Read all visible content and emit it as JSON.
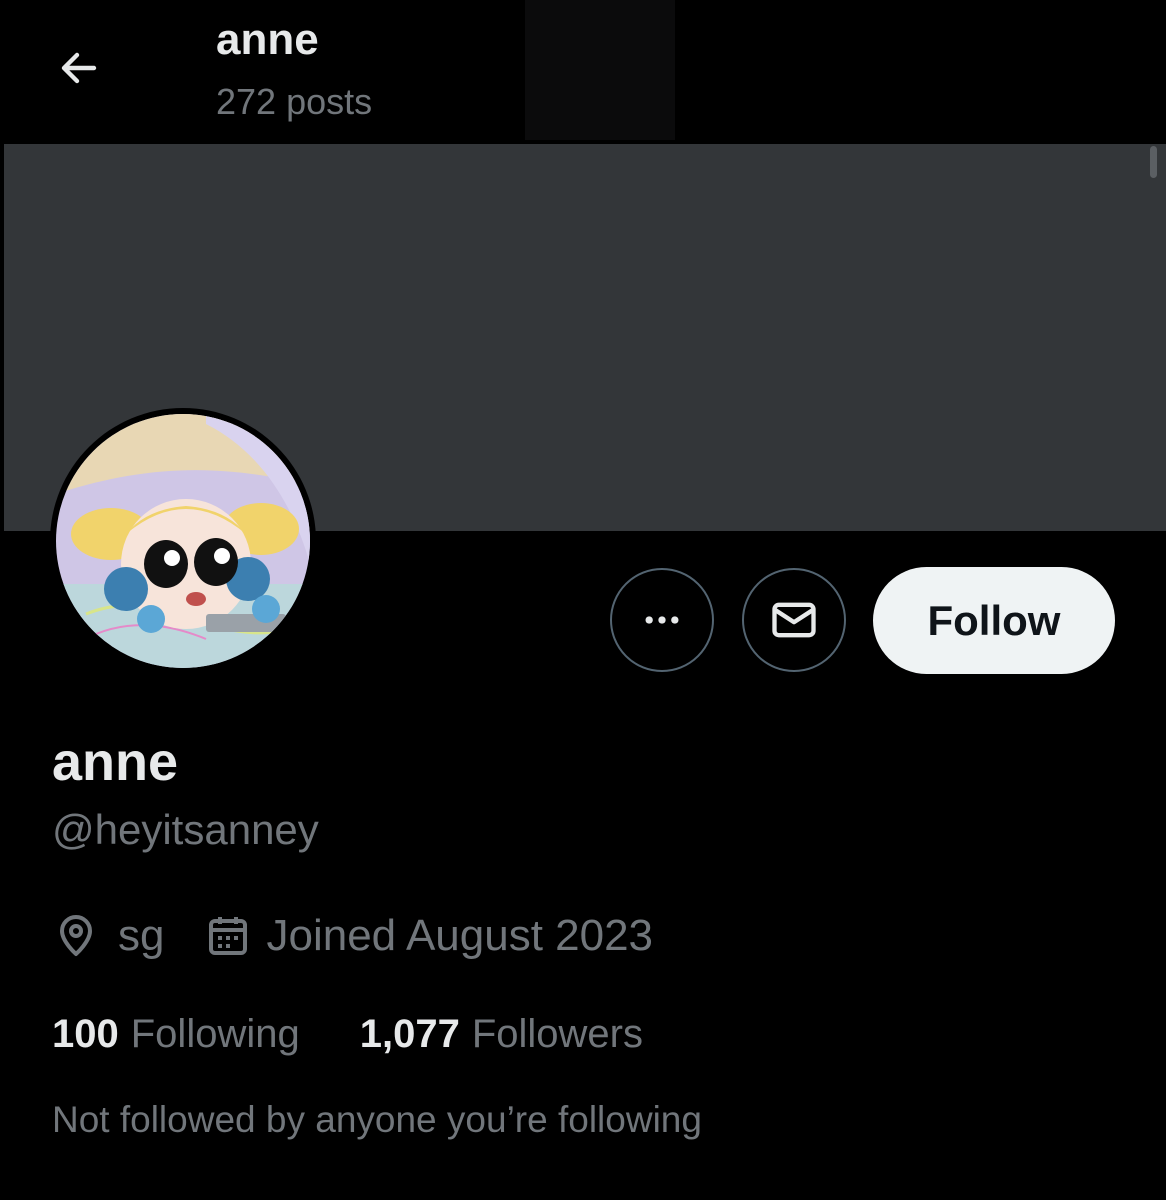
{
  "header": {
    "title": "anne",
    "post_count": "272 posts",
    "back_icon": "arrow-left-icon"
  },
  "banner": {
    "color": "#333639"
  },
  "avatar": {
    "description_icon": "avatar-image"
  },
  "actions": {
    "more_icon": "more-horizontal-icon",
    "message_icon": "envelope-icon",
    "follow_label": "Follow"
  },
  "profile": {
    "display_name": "anne",
    "handle": "@heyitsanney",
    "location": "sg",
    "location_icon": "location-pin-icon",
    "joined": "Joined August 2023",
    "joined_icon": "calendar-icon",
    "following_count": "100",
    "following_label": "Following",
    "followers_count": "1,077",
    "followers_label": "Followers",
    "followed_by": "Not followed by anyone you’re following"
  },
  "colors": {
    "background": "#000000",
    "primary_text": "#e7e9ea",
    "secondary_text": "#71767b",
    "follow_button_bg": "#eff3f4",
    "border": "#536471"
  }
}
